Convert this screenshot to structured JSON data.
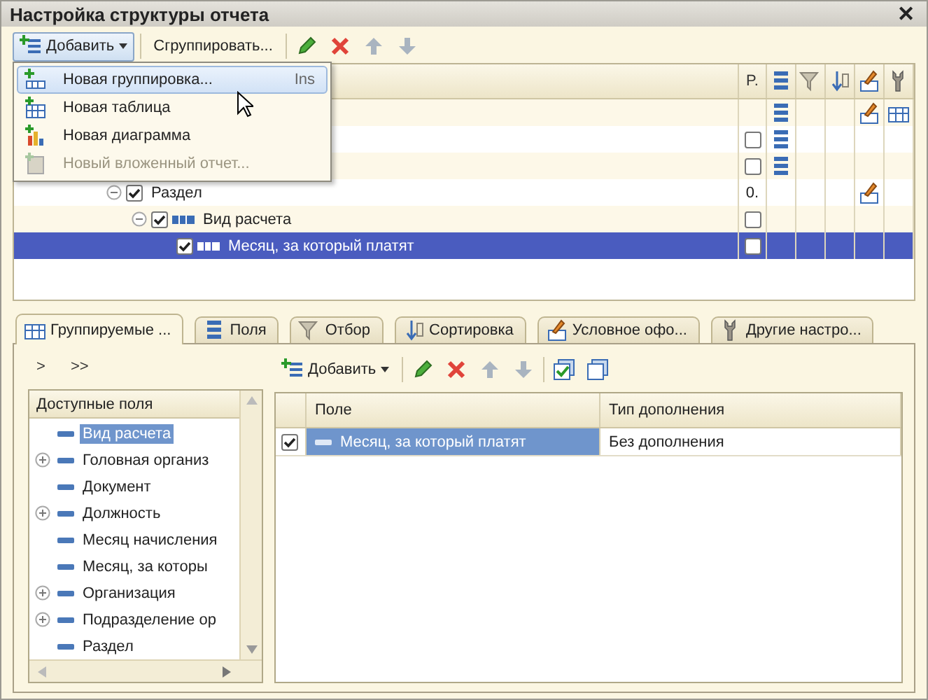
{
  "window": {
    "title": "Настройка структуры отчета",
    "close": "✕"
  },
  "toolbar": {
    "add": "Добавить",
    "group": "Сгруппировать..."
  },
  "menu": [
    {
      "label": "Новая группировка...",
      "shortcut": "Ins",
      "kind": "grouping",
      "selected": true,
      "disabled": false
    },
    {
      "label": "Новая таблица",
      "kind": "table",
      "selected": false,
      "disabled": false
    },
    {
      "label": "Новая диаграмма",
      "kind": "chart",
      "selected": false,
      "disabled": false
    },
    {
      "label": "Новый вложенный отчет...",
      "kind": "nested",
      "selected": false,
      "disabled": true
    }
  ],
  "structure": {
    "columns": [
      {
        "label": "P."
      }
    ],
    "rows": [
      {
        "fields": true,
        "appearance": true,
        "settings": true,
        "selected": false,
        "children": [
          {
            "p": {
              "kind": "checkbox",
              "checked": false
            },
            "fields": true,
            "selected": false,
            "children": [
              {
                "p": {
                  "kind": "checkbox",
                  "checked": false
                },
                "fields": true,
                "selected": false
              },
              {
                "label": "Раздел",
                "checked": true,
                "expanded": true,
                "p": {
                  "kind": "text",
                  "text": "0."
                },
                "appearance": true,
                "selected": false,
                "children": [
                  {
                    "label": "Вид расчета",
                    "checked": true,
                    "expanded": true,
                    "p": {
                      "kind": "checkbox",
                      "checked": false
                    },
                    "selected": false,
                    "children": [
                      {
                        "label": "Месяц, за который платят",
                        "checked": true,
                        "p": {
                          "kind": "checkbox",
                          "checked": false
                        },
                        "selected": true
                      }
                    ]
                  }
                ]
              }
            ]
          }
        ]
      }
    ]
  },
  "tabs": [
    {
      "label": "Группируемые ...",
      "selected": true
    },
    {
      "label": "Поля",
      "selected": false
    },
    {
      "label": "Отбор",
      "selected": false
    },
    {
      "label": "Сортировка",
      "selected": false
    },
    {
      "label": "Условное офо...",
      "selected": false
    },
    {
      "label": "Другие настро...",
      "selected": false
    }
  ],
  "move_buttons": [
    ">",
    ">>"
  ],
  "available": {
    "header": "Доступные поля",
    "items": [
      {
        "label": "Вид расчета",
        "expandable": false,
        "selected": true
      },
      {
        "label": "Головная организ",
        "expandable": true,
        "selected": false
      },
      {
        "label": "Документ",
        "expandable": false,
        "selected": false
      },
      {
        "label": "Должность",
        "expandable": true,
        "selected": false
      },
      {
        "label": "Месяц начисления",
        "expandable": false,
        "selected": false
      },
      {
        "label": "Месяц, за которы",
        "expandable": false,
        "selected": false
      },
      {
        "label": "Организация",
        "expandable": true,
        "selected": false
      },
      {
        "label": "Подразделение ор",
        "expandable": true,
        "selected": false
      },
      {
        "label": "Раздел",
        "expandable": false,
        "selected": false
      }
    ]
  },
  "group_fields": {
    "add": "Добавить",
    "columns": [
      "Поле",
      "Тип дополнения"
    ],
    "rows": [
      {
        "checked": true,
        "field": "Месяц, за который платят",
        "type": "Без дополнения",
        "selected": true
      }
    ]
  }
}
